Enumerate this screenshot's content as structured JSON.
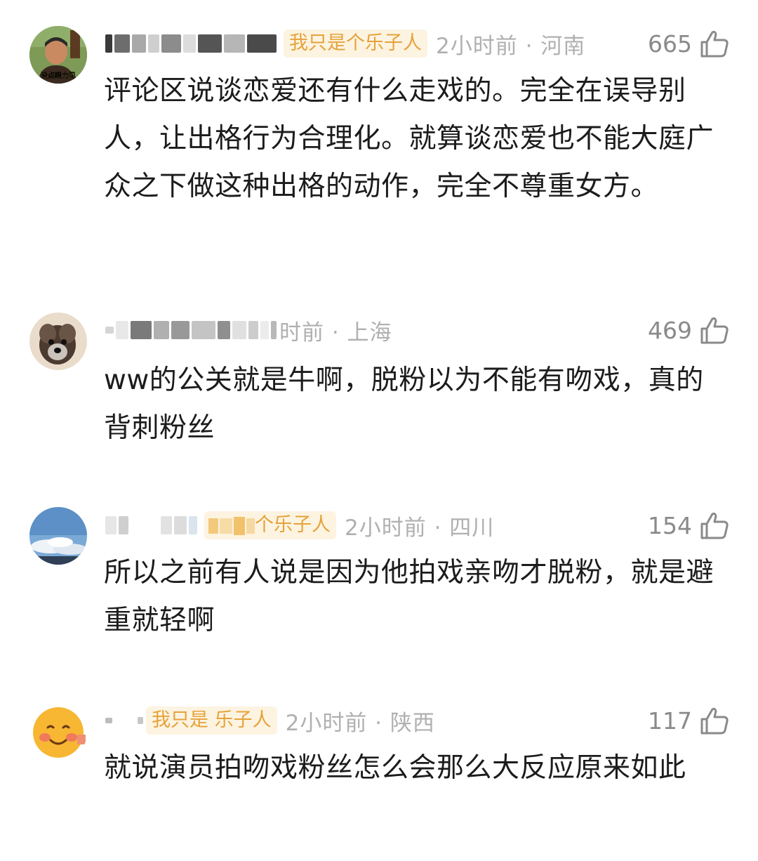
{
  "comments": [
    {
      "avatar_caption": "没点眼力见",
      "badge": "我只是个乐子人",
      "time_loc": "2小时前 · 河南",
      "likes": "665",
      "text": "评论区说谈恋爱还有什么走戏的。完全在误导别人，让出格行为合理化。就算谈恋爱也不能大庭广众之下做这种出格的动作，完全不尊重女方。"
    },
    {
      "time_loc": "时前 · 上海",
      "likes": "469",
      "text": "ww的公关就是牛啊，脱粉以为不能有吻戏，真的背刺粉丝"
    },
    {
      "badge": "个乐子人",
      "time_loc": "2小时前 · 四川",
      "likes": "154",
      "text": "所以之前有人说是因为他拍戏亲吻才脱粉，就是避重就轻啊"
    },
    {
      "badge": "我只是 乐子人",
      "time_loc": "2小时前 · 陕西",
      "likes": "117",
      "text": "就说演员拍吻戏粉丝怎么会那么大反应原来如此"
    }
  ],
  "icons": {
    "like": "thumbs-up-icon"
  },
  "colors": {
    "badge_bg": "#fdf3e1",
    "badge_text": "#e5a33a",
    "meta_gray": "#b0b0b0",
    "like_gray": "#8a8a8a",
    "text": "#1c1c1c"
  }
}
